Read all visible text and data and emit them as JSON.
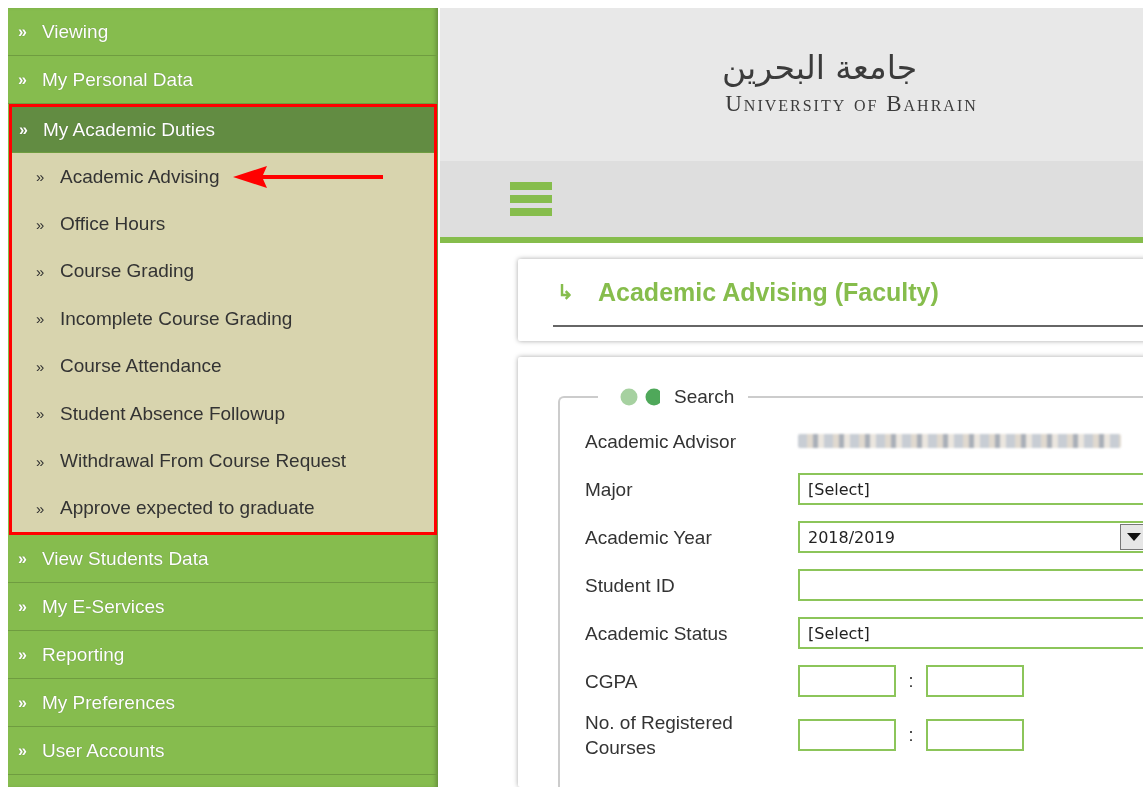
{
  "sidebar": {
    "items": [
      {
        "marker": "»",
        "label": "Viewing",
        "expanded": false
      },
      {
        "marker": "»",
        "label": "My Personal Data",
        "expanded": false
      },
      {
        "marker": "»",
        "label": "My Academic Duties",
        "expanded": true,
        "highlighted": true,
        "children": [
          {
            "marker": "»",
            "label": "Academic Advising",
            "pointed": true
          },
          {
            "marker": "»",
            "label": "Office Hours",
            "pointed": false
          },
          {
            "marker": "»",
            "label": "Course Grading",
            "pointed": false
          },
          {
            "marker": "»",
            "label": "Incomplete Course Grading",
            "pointed": false
          },
          {
            "marker": "»",
            "label": "Course Attendance",
            "pointed": false
          },
          {
            "marker": "»",
            "label": "Student Absence Followup",
            "pointed": false
          },
          {
            "marker": "»",
            "label": "Withdrawal From Course Request",
            "pointed": false
          },
          {
            "marker": "»",
            "label": "Approve expected to graduate",
            "pointed": false
          }
        ]
      },
      {
        "marker": "»",
        "label": "View Students Data",
        "expanded": false
      },
      {
        "marker": "»",
        "label": "My E-Services",
        "expanded": false
      },
      {
        "marker": "»",
        "label": "Reporting",
        "expanded": false
      },
      {
        "marker": "»",
        "label": "My Preferences",
        "expanded": false
      },
      {
        "marker": "»",
        "label": "User Accounts",
        "expanded": false
      }
    ]
  },
  "header": {
    "title_arabic": "جامعة البحرين",
    "title_english": "University of Bahrain"
  },
  "page_title": {
    "icon": "↳",
    "text": "Academic Advising (Faculty)"
  },
  "search": {
    "legend": "Search",
    "fields": [
      {
        "kind": "redacted",
        "label": "Academic Advisor"
      },
      {
        "kind": "select",
        "label": "Major",
        "value": "[Select]"
      },
      {
        "kind": "dropdown",
        "label": "Academic Year",
        "value": "2018/2019"
      },
      {
        "kind": "input",
        "label": "Student ID"
      },
      {
        "kind": "select",
        "label": "Academic Status",
        "value": "[Select]"
      },
      {
        "kind": "range",
        "label": "CGPA",
        "separator": ":"
      },
      {
        "kind": "range",
        "label": "No. of Registered Courses",
        "separator": ":"
      }
    ]
  }
}
